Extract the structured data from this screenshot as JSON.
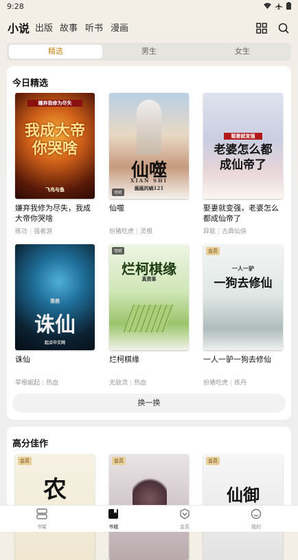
{
  "status": {
    "time": "9:28"
  },
  "nav": {
    "tabs": [
      "小说",
      "出版",
      "故事",
      "听书",
      "漫画"
    ]
  },
  "segments": [
    "精选",
    "男生",
    "女生"
  ],
  "section1": {
    "title": "今日精选",
    "books": [
      {
        "title": "嫌弃我修为尽失，我成大帝你哭啥",
        "tag1": "练功",
        "tag2": "强者游",
        "cover_text": "我成大帝你哭啥",
        "cover_small": "嫌弃我修为尽失",
        "cover_author": "飞鸟与鱼"
      },
      {
        "title": "仙噬",
        "tag1": "扮猪吃虎",
        "tag2": "灵根",
        "cover_text": "仙噬",
        "cover_sub": "XIAN SHI",
        "cover_author": "瘋瘋的蝸121",
        "cover_badge": "可听"
      },
      {
        "title": "娶妻就变强，老婆怎么都成仙帝了",
        "tag1": "异能",
        "tag2": "古典仙侠",
        "cover_text": "老婆怎么都成仙帝了",
        "cover_small": "娶妻就变强"
      },
      {
        "title": "诛仙",
        "tag1": "草根崛起",
        "tag2": "热血",
        "cover_text": "诛仙",
        "cover_author": "萧鼎",
        "cover_pub": "起点中文网"
      },
      {
        "title": "烂柯棋缘",
        "tag1": "无敌流",
        "tag2": "热血",
        "cover_text": "烂柯棋缘",
        "cover_author": "真费事",
        "cover_badge": "可听"
      },
      {
        "title": "一人一驴一狗去修仙",
        "tag1": "扮猪吃虎",
        "tag2": "练丹",
        "cover_text": "一狗去修仙",
        "cover_small": "一人一驴",
        "cover_badge": "会员"
      }
    ],
    "refresh_label": "换一换"
  },
  "section2": {
    "title": "高分佳作",
    "covers": [
      {
        "badge": "会员",
        "text": "农"
      },
      {
        "badge": "会员",
        "text": ""
      },
      {
        "badge": "会员",
        "text": "仙御"
      }
    ]
  },
  "bottom_nav": [
    "书架",
    "书城",
    "会员",
    "我的"
  ]
}
